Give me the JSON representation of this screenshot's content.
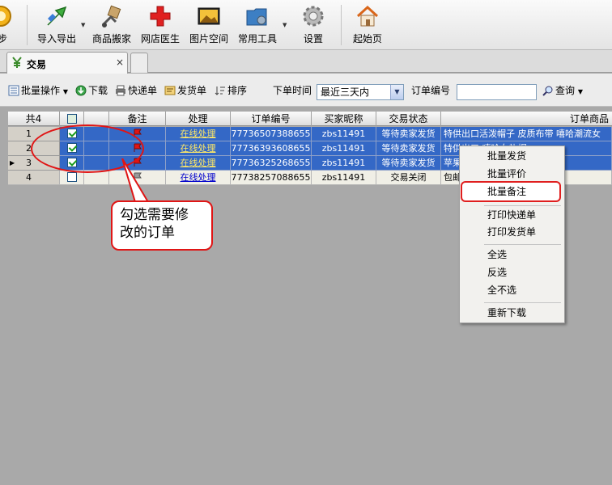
{
  "toolbar": {
    "items": [
      {
        "label": "步",
        "icon": "sync-icon"
      },
      {
        "label": "导入导出",
        "icon": "import-export-icon"
      },
      {
        "label": "商品搬家",
        "icon": "move-products-icon"
      },
      {
        "label": "网店医生",
        "icon": "red-cross-icon"
      },
      {
        "label": "图片空间",
        "icon": "picture-icon"
      },
      {
        "label": "常用工具",
        "icon": "tools-folder-icon"
      },
      {
        "label": "设置",
        "icon": "gear-icon"
      },
      {
        "label": "起始页",
        "icon": "home-icon"
      }
    ]
  },
  "tabs": {
    "active": {
      "label": "交易",
      "close": "×",
      "icon": "trade-icon"
    }
  },
  "actionbar": {
    "batch_ops": "批量操作",
    "download": "下载",
    "express_bill": "快递单",
    "delivery_bill": "发货单",
    "sort": "排序",
    "order_time_label": "下单时间",
    "order_time_value": "最近三天内",
    "order_no_label": "订单编号",
    "order_no_value": "",
    "query": "查询"
  },
  "grid": {
    "headers": {
      "count": "共4",
      "note": "备注",
      "handle": "处理",
      "order_no": "订单编号",
      "buyer": "买家昵称",
      "status": "交易状态",
      "product": "订单商品"
    },
    "rows": [
      {
        "idx": "1",
        "checked": true,
        "flag": "red",
        "handle": "在线处理",
        "order_no": "77736507388655",
        "buyer": "zbs11491",
        "status": "等待卖家发货",
        "product": "特供出口活泼帽子 皮质布带 嘻哈潮流女"
      },
      {
        "idx": "2",
        "checked": true,
        "flag": "red",
        "handle": "在线处理",
        "order_no": "77736393608655",
        "buyer": "zbs11491",
        "status": "等待卖家发货",
        "product": "特供出口 嘻哈女礼帽"
      },
      {
        "idx": "3",
        "checked": true,
        "flag": "red",
        "handle": "在线处理",
        "order_no": "77736325268655",
        "buyer": "zbs11491",
        "status": "等待卖家发货",
        "product": "苹果 air U盘"
      },
      {
        "idx": "4",
        "checked": false,
        "flag": "grey",
        "handle": "在线处理",
        "order_no": "77738257088655",
        "buyer": "zbs11491",
        "status": "交易关闭",
        "product": "包邮 525 有港4G"
      }
    ]
  },
  "menu": {
    "items": [
      "批量发货",
      "批量评价",
      "批量备注",
      "打印快递单",
      "打印发货单",
      "全选",
      "反选",
      "全不选",
      "重新下载"
    ],
    "highlighted": "批量备注"
  },
  "annotation": {
    "line1": "勾选需要修",
    "line2": "改的订单"
  },
  "colors": {
    "selection": "#3468c6",
    "annotation_red": "#e01515"
  }
}
